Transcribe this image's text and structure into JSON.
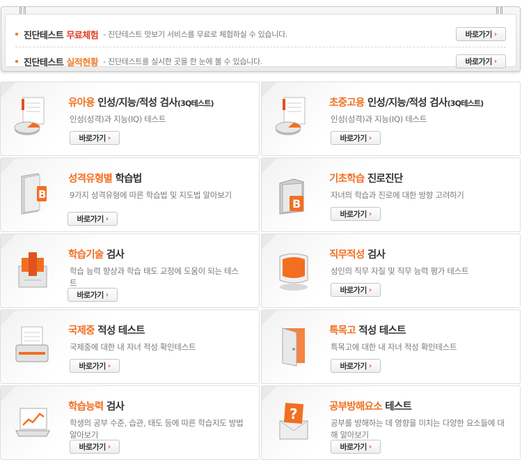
{
  "notice": {
    "items": [
      {
        "title_prefix": "진단테스트 ",
        "title_highlight": "무료체험",
        "description": "- 진단테스트 맛보기 서비스를 무료로 체험하실 수 있습니다.",
        "button": "바로가기"
      },
      {
        "title_prefix": "진단테스트 ",
        "title_highlight": "실적현황",
        "description": "- 진단테스트를 실시한 곳을 한 눈에 볼 수 있습니다.",
        "button": "바로가기"
      }
    ]
  },
  "cards": [
    {
      "highlight": "유아용",
      "title_rest": " 인성/지능/적성 검사",
      "title_small": "(3Q테스트)",
      "description": "인성(성격)과 지능(IQ) 테스트",
      "button": "바로가기",
      "icon": "document-chart-icon"
    },
    {
      "highlight": "초중고용",
      "title_rest": " 인성/지능/적성 검사",
      "title_small": "(3Q테스트)",
      "description": "인성(성격)과 지능(IQ) 테스트",
      "button": "바로가기",
      "icon": "document-chart-icon"
    },
    {
      "highlight": "성격유형별",
      "title_rest": " 학습법",
      "title_small": "",
      "description": "9가지 성격유형에 따른 학습법 및 지도법 알아보기",
      "button": "바로가기",
      "icon": "book-b-icon"
    },
    {
      "highlight": "기초학습",
      "title_rest": " 진로진단",
      "title_small": "",
      "description": "자녀의 학습과 진로에 대한 방향 고려하기",
      "button": "바로가기",
      "icon": "folder-b-icon"
    },
    {
      "highlight": "학습기술",
      "title_rest": " 검사",
      "title_small": "",
      "description": "학습 능력 향상과 학습 태도 교정에 도움이 되는 테스트",
      "button": "바로가기",
      "icon": "binder-icon"
    },
    {
      "highlight": "직무적성",
      "title_rest": " 검사",
      "title_small": "",
      "description": "성인의 직무 자질 및 직무 능력 평가 테스트",
      "button": "바로가기",
      "icon": "computer-icon"
    },
    {
      "highlight": "국제중",
      "title_rest": " 적성 테스트",
      "title_small": "",
      "description": "국제중에 대한 내 자녀 적성 확인테스트",
      "button": "바로가기",
      "icon": "printer-icon"
    },
    {
      "highlight": "특목고",
      "title_rest": " 적성 테스트",
      "title_small": "",
      "description": "특목고에 대한 내 자녀 적성 확인테스트",
      "button": "바로가기",
      "icon": "door-icon"
    },
    {
      "highlight": "학습능력",
      "title_rest": " 검사",
      "title_small": "",
      "description": "학생의 공부 수준, 습관, 태도 등에 따른 학습지도 방법 알아보기",
      "button": "바로가기",
      "icon": "laptop-chart-icon"
    },
    {
      "highlight": "공부방해요소",
      "title_rest": " 테스트",
      "title_small": "",
      "description": "공부를 방해하는 데 영향을 미치는 다양한 요소들에 대해 알아보기",
      "button": "바로가기",
      "icon": "question-envelope-icon"
    }
  ],
  "colors": {
    "accent_orange": "#f26f21",
    "accent_red": "#e23b1e"
  }
}
